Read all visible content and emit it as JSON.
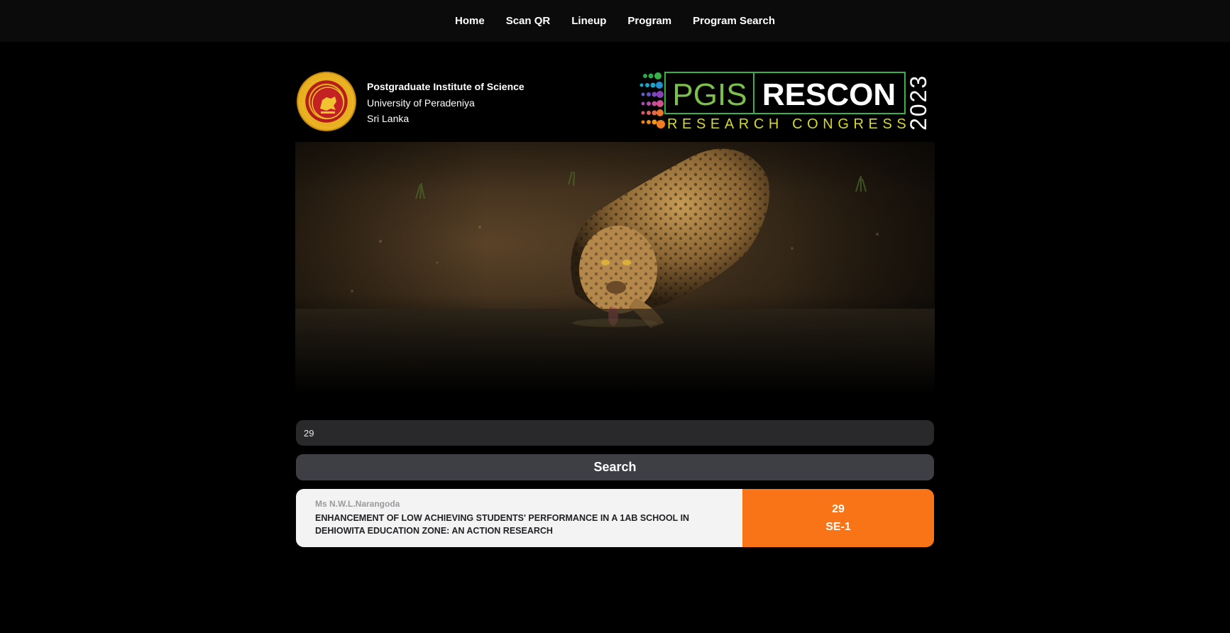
{
  "nav": {
    "items": [
      {
        "label": "Home"
      },
      {
        "label": "Scan QR"
      },
      {
        "label": "Lineup"
      },
      {
        "label": "Program"
      },
      {
        "label": "Program Search"
      }
    ]
  },
  "header": {
    "institute": "Postgraduate Institute of Science",
    "university": "University of Peradeniya",
    "country": "Sri Lanka",
    "logo": {
      "pgis": "PGIS",
      "rescon": "RESCON",
      "subtitle": "RESEARCH CONGRESS",
      "year": "2023"
    }
  },
  "hero": {
    "icon": "leopard-photo"
  },
  "search": {
    "value": "29",
    "button_label": "Search"
  },
  "results": [
    {
      "author": "Ms N.W.L.Narangoda",
      "title": "ENHANCEMENT OF LOW ACHIEVING STUDENTS' PERFORMANCE IN A 1AB SCHOOL IN DEHIOWITA EDUCATION ZONE: AN ACTION RESEARCH",
      "number": "29",
      "session": "SE-1"
    }
  ],
  "colors": {
    "accent": "#f97416",
    "nav_bg": "#0b0b0c",
    "input_bg": "#29292c",
    "button_bg": "#3e3f45",
    "logo_green": "#7cc04b",
    "logo_yellow": "#d6d92a"
  }
}
